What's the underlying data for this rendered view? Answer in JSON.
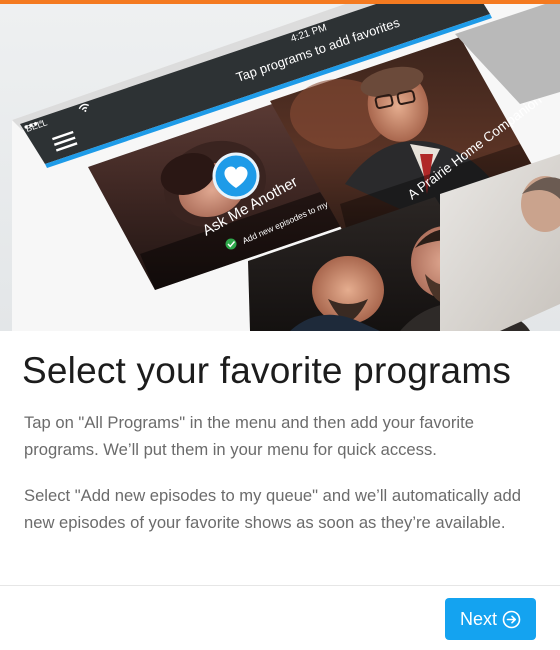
{
  "device": {
    "time": "4:21 PM",
    "carrier": "BELL",
    "screen_title": "Tap programs to add favorites"
  },
  "cards": [
    {
      "title": "Ask Me Another",
      "queue_label": "Add new episodes to my queue",
      "favorite": true
    },
    {
      "title": "A Prairie Home Companion"
    }
  ],
  "onboarding": {
    "title": "Select your favorite programs",
    "paragraph_1": "Tap on \"All Programs\" in the menu and then add your favorite programs. We’ll put them in your menu for quick access.",
    "paragraph_2": "Select \"Add new episodes to my queue\" and we’ll automatically add new episodes of your favorite shows as soon as they’re available."
  },
  "footer": {
    "next_label": "Next"
  },
  "colors": {
    "accent_top": "#f47a20",
    "primary_button": "#14a3f0",
    "highlight_line": "#1e9be8",
    "check_green": "#2ea84b"
  },
  "icons": [
    "menu-icon",
    "wifi-icon",
    "heart-icon",
    "check-icon",
    "arrow-right-circle-icon"
  ]
}
